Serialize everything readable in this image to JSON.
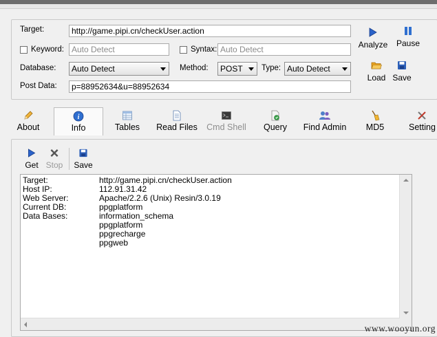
{
  "form": {
    "target_label": "Target:",
    "target_value": "http://game.pipi.cn/checkUser.action",
    "keyword_label": "Keyword:",
    "keyword_placeholder": "Auto Detect",
    "syntax_label": "Syntax:",
    "syntax_placeholder": "Auto Detect",
    "database_label": "Database:",
    "database_value": "Auto Detect",
    "method_label": "Method:",
    "method_value": "POST",
    "type_label": "Type:",
    "type_value": "Auto Detect",
    "postdata_label": "Post Data:",
    "postdata_value": "p=88952634&u=88952634"
  },
  "actions": {
    "analyze": "Analyze",
    "pause": "Pause",
    "load": "Load",
    "save": "Save"
  },
  "tabs": [
    {
      "label": "About"
    },
    {
      "label": "Info"
    },
    {
      "label": "Tables"
    },
    {
      "label": "Read Files"
    },
    {
      "label": "Cmd Shell"
    },
    {
      "label": "Query"
    },
    {
      "label": "Find Admin"
    },
    {
      "label": "MD5"
    },
    {
      "label": "Setting"
    }
  ],
  "toolbar": {
    "get": "Get",
    "stop": "Stop",
    "save": "Save"
  },
  "output": {
    "rows": [
      {
        "key": "Target:",
        "value": "http://game.pipi.cn/checkUser.action"
      },
      {
        "key": "Host IP:",
        "value": "112.91.31.42"
      },
      {
        "key": "Web Server:",
        "value": "Apache/2.2.6 (Unix) Resin/3.0.19"
      },
      {
        "key": "Current DB:",
        "value": "ppgplatform"
      },
      {
        "key": "Data Bases:",
        "value": "information_schema"
      },
      {
        "key": "",
        "value": "ppgplatform"
      },
      {
        "key": "",
        "value": "ppgrecharge"
      },
      {
        "key": "",
        "value": "ppgweb"
      }
    ]
  },
  "watermark": "www.wooyun.org",
  "colors": {
    "play_blue": "#2b63c9",
    "pause_blue": "#2f6fd0",
    "folder_orange": "#e9a21e"
  }
}
